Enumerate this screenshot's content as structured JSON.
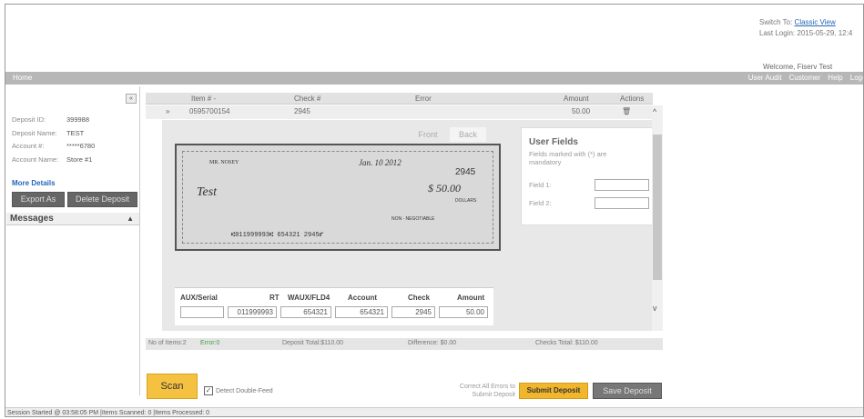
{
  "header": {
    "switch_label": "Switch To:",
    "switch_link": "Classic View",
    "last_login": "Last Login: 2015-05-29, 12:4",
    "welcome": "Welcome, Fiserv Test"
  },
  "topbar": {
    "home": "Home",
    "links": [
      "User Audit",
      "Customer",
      "Help",
      "Logou"
    ]
  },
  "deposit": {
    "collapse_glyph": "«",
    "fields": [
      {
        "label": "Deposit ID:",
        "value": "399988"
      },
      {
        "label": "Deposit Name:",
        "value": "TEST"
      },
      {
        "label": "Account #:",
        "value": "*****6780"
      },
      {
        "label": "Account Name:",
        "value": "Store #1"
      }
    ],
    "more_details": "More Details",
    "export_label": "Export As",
    "delete_label": "Delete Deposit"
  },
  "messages": {
    "title": "Messages",
    "arrow": "▲"
  },
  "table": {
    "headers": [
      "Item # -",
      "Check #",
      "Error",
      "Amount",
      "Actions"
    ],
    "row": {
      "expander": "»",
      "item": "0595700154",
      "check": "2945",
      "error": "",
      "amount": "50.00",
      "action_icon": "🗑"
    }
  },
  "detail": {
    "front_tab": "Front",
    "back_tab": "Back",
    "check": {
      "payee_name": "MR. NOSEY",
      "memo_name": "Test",
      "date": "Jan. 10 2012",
      "number": "2945",
      "amount": "$ 50.00",
      "dollars": "DOLLARS",
      "non_negotiable": "NON - NEGOTIABLE",
      "micr": "⑆011999993⑆ 654321 2945⑈"
    },
    "user_fields": {
      "title": "User Fields",
      "subtitle": "Fields marked with (*) are mandatory",
      "field1": "Field 1:",
      "field2": "Field 2:"
    },
    "grid": {
      "headers": [
        "AUX/Serial",
        "RT",
        "WAUX/FLD4",
        "Account",
        "Check",
        "Amount"
      ],
      "values": [
        "",
        "011999993",
        "654321",
        "654321",
        "2945",
        "50.00"
      ]
    }
  },
  "scroll": {
    "up": "^",
    "down": "v"
  },
  "summary": {
    "items": "No of Items:2",
    "errors": "Error:0",
    "deposit_total": "Deposit Total:$110.00",
    "difference": "Difference: $0.00",
    "checks_total": "Checks Total: $110.00"
  },
  "actions": {
    "scan": "Scan",
    "detect_double_feed": "Detect Double-Feed",
    "checkmark": "✓",
    "correct_note": "Correct All Errors to Submit Deposit",
    "submit": "Submit Deposit",
    "save": "Save Deposit"
  },
  "status": "Session Started @ 03:58:05 PM |Items Scanned: 0 |Items Processed: 0"
}
